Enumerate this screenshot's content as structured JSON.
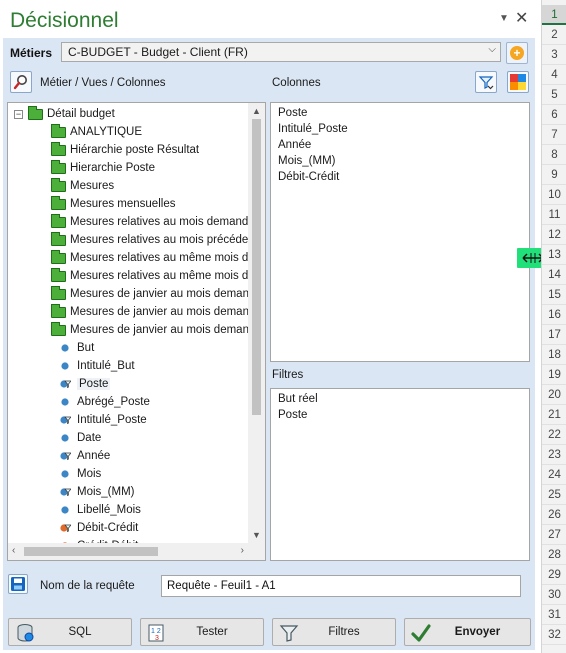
{
  "pane": {
    "title": "Décisionnel",
    "menu_icon": "chevron-down-icon",
    "close_icon": "close-icon"
  },
  "metiers": {
    "label": "Métiers",
    "selected": "C-BUDGET - Budget - Client (FR)"
  },
  "tree": {
    "header": "Métier / Vues / Colonnes",
    "root": "Détail budget",
    "items": [
      {
        "label": "ANALYTIQUE",
        "icon": "folder"
      },
      {
        "label": "Hiérarchie poste Résultat",
        "icon": "folder"
      },
      {
        "label": "Hierarchie Poste",
        "icon": "folder"
      },
      {
        "label": "Mesures",
        "icon": "folder"
      },
      {
        "label": "Mesures mensuelles",
        "icon": "folder"
      },
      {
        "label": "Mesures relatives au mois demandé",
        "icon": "folder"
      },
      {
        "label": "Mesures relatives au mois précédent",
        "icon": "folder"
      },
      {
        "label": "Mesures relatives au même mois de",
        "icon": "folder"
      },
      {
        "label": "Mesures relatives au même mois de",
        "icon": "folder"
      },
      {
        "label": "Mesures de janvier au mois demandé",
        "icon": "folder"
      },
      {
        "label": "Mesures de janvier au mois demandé",
        "icon": "folder"
      },
      {
        "label": "Mesures de janvier au mois demandé",
        "icon": "folder"
      },
      {
        "label": "But",
        "icon": "blue-dot"
      },
      {
        "label": "Intitulé_But",
        "icon": "blue-dot"
      },
      {
        "label": "Poste",
        "icon": "blue-filter-dot",
        "selected": true
      },
      {
        "label": "Abrégé_Poste",
        "icon": "blue-dot"
      },
      {
        "label": "Intitulé_Poste",
        "icon": "blue-filter-dot"
      },
      {
        "label": "Date",
        "icon": "blue-dot"
      },
      {
        "label": "Année",
        "icon": "blue-filter-dot"
      },
      {
        "label": "Mois",
        "icon": "blue-dot"
      },
      {
        "label": "Mois_(MM)",
        "icon": "blue-filter-dot"
      },
      {
        "label": "Libellé_Mois",
        "icon": "blue-dot"
      },
      {
        "label": "Débit-Crédit",
        "icon": "orange-filter-dot"
      },
      {
        "label": "Crédit-Débit",
        "icon": "orange-dot"
      }
    ]
  },
  "columns": {
    "header": "Colonnes",
    "items": [
      "Poste",
      "Intitulé_Poste",
      "Année",
      "Mois_(MM)",
      "Débit-Crédit"
    ]
  },
  "filters": {
    "header": "Filtres",
    "items": [
      "But réel",
      "Poste"
    ]
  },
  "request": {
    "label": "Nom de la requête",
    "value": "Requête - Feuil1 - A1"
  },
  "buttons": {
    "sql": "SQL",
    "tester": "Tester",
    "filtres": "Filtres",
    "envoyer": "Envoyer"
  },
  "rows": [
    "1",
    "2",
    "3",
    "4",
    "5",
    "6",
    "7",
    "8",
    "9",
    "10",
    "11",
    "12",
    "13",
    "14",
    "15",
    "16",
    "17",
    "18",
    "19",
    "20",
    "21",
    "22",
    "23",
    "24",
    "25",
    "26",
    "27",
    "28",
    "29",
    "30",
    "31",
    "32"
  ],
  "colors": {
    "title_green": "#2e7d32",
    "panel_bg": "#dbe6f4",
    "splitter": "#21e07a",
    "row_active": "#217346"
  }
}
